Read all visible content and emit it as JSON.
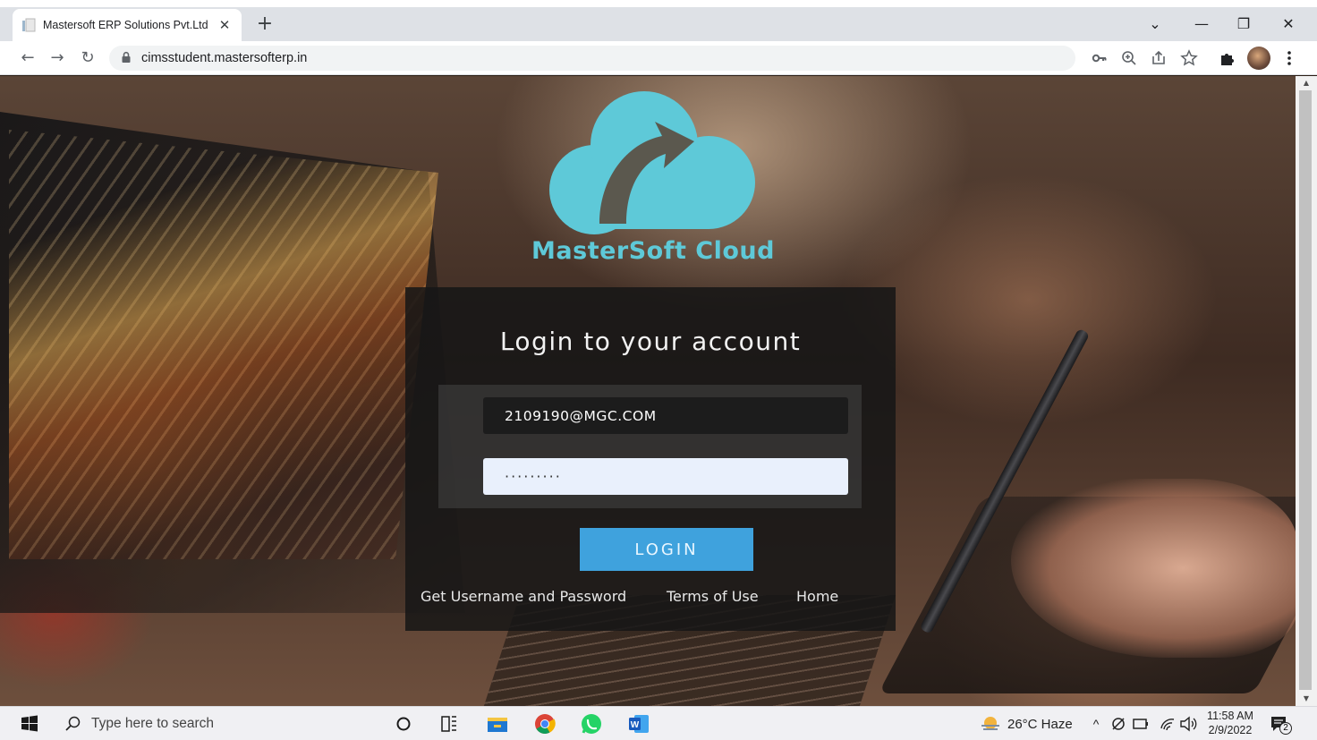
{
  "browser": {
    "tab_title": "Mastersoft ERP Solutions Pvt.Ltd",
    "tab_close": "✕",
    "new_tab": "+",
    "url": "cimsstudent.mastersofterp.in",
    "window_controls": {
      "tab_search": "⌄",
      "minimize": "—",
      "restore": "❐",
      "close": "✕"
    },
    "nav": {
      "back": "←",
      "forward": "→",
      "reload": "↻"
    },
    "toolbar_icons": [
      "key-icon",
      "zoom-icon",
      "share-icon",
      "star-icon",
      "extensions-icon",
      "profile-avatar",
      "menu-icon"
    ]
  },
  "page": {
    "brand": "MasterSoft Cloud",
    "heading": "Login to your account",
    "username_value": "2109190@MGC.COM",
    "password_value": "·········",
    "login_label": "LOGIN",
    "links": [
      "Get Username and Password",
      "Terms of Use",
      "Home"
    ],
    "colors": {
      "logo": "#5ec9d8",
      "login_button": "#3fa2dd"
    }
  },
  "taskbar": {
    "search_placeholder": "Type here to search",
    "weather": "26°C  Haze",
    "time": "11:58 AM",
    "date": "2/9/2022",
    "notification_count": "2"
  }
}
